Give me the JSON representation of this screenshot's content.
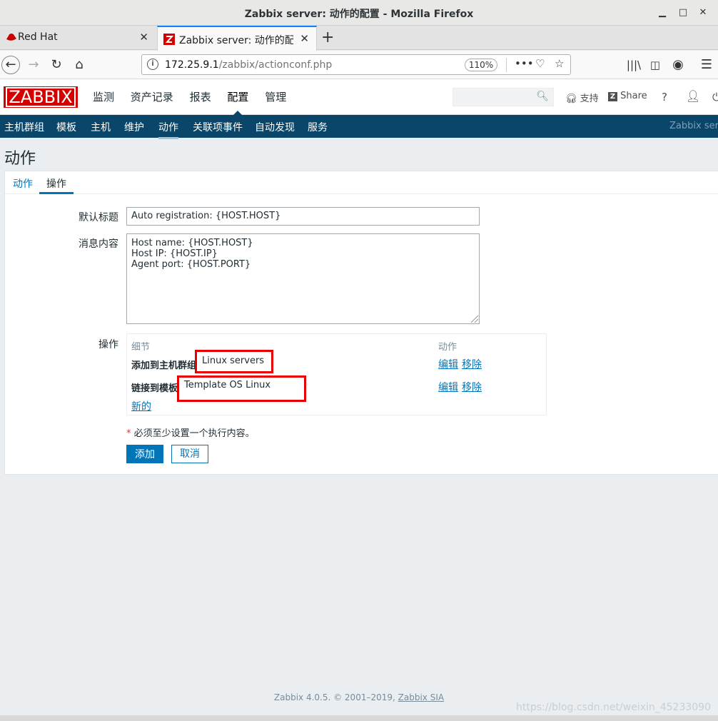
{
  "window": {
    "title": "Zabbix server: 动作的配置 - Mozilla Firefox"
  },
  "tabs": [
    {
      "label": "Red Hat"
    },
    {
      "label": "Zabbix server: 动作的配置"
    }
  ],
  "nav": {
    "url_host": "172.25.9.1",
    "url_path": "/zabbix/actionconf.php",
    "zoom": "110%"
  },
  "zabbix": {
    "logo": "ZABBIX",
    "main_menu": [
      "监测",
      "资产记录",
      "报表",
      "配置",
      "管理"
    ],
    "support": "支持",
    "share": "Share",
    "help": "?",
    "sub_menu": [
      "主机群组",
      "模板",
      "主机",
      "维护",
      "动作",
      "关联项事件",
      "自动发现",
      "服务"
    ],
    "server_name": "Zabbix server"
  },
  "page": {
    "title": "动作"
  },
  "form": {
    "tabs": [
      "动作",
      "操作"
    ],
    "default_subject_label": "默认标题",
    "default_subject_value": "Auto registration: {HOST.HOST}",
    "message_label": "消息内容",
    "message_lines": [
      "Host name: {HOST.HOST}",
      "Host IP: {HOST.IP}",
      "Agent port: {HOST.PORT}"
    ],
    "operations_label": "操作",
    "ops_header_details": "细节",
    "ops_header_action": "动作",
    "op1_label": "添加到主机群组",
    "op1_value": "Linux servers",
    "op2_label": "链接到模板",
    "op2_value": "Template OS Linux",
    "edit": "编辑",
    "remove": "移除",
    "new": "新的",
    "required_note": "必须至少设置一个执行内容。",
    "add_button": "添加",
    "cancel_button": "取消"
  },
  "footer": {
    "text": "Zabbix 4.0.5. © 2001–2019,",
    "link": "Zabbix SIA"
  },
  "watermark": "https://blog.csdn.net/weixin_45233090"
}
